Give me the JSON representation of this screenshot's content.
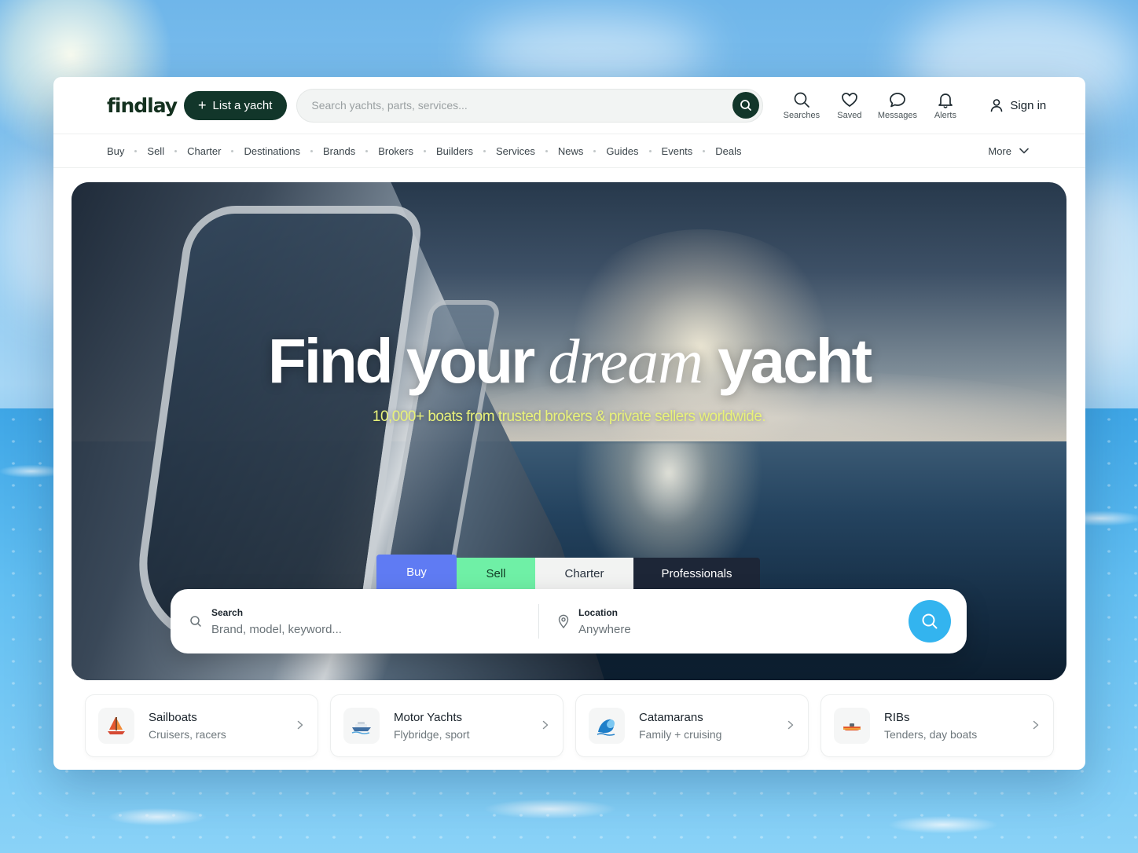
{
  "brand": {
    "name": "findlay"
  },
  "header": {
    "list_button": "List a yacht",
    "search_placeholder": "Search yachts, parts, services...",
    "actions": [
      {
        "label": "Searches",
        "icon": "search-icon"
      },
      {
        "label": "Saved",
        "icon": "heart-icon"
      },
      {
        "label": "Messages",
        "icon": "chat-bubble-icon"
      },
      {
        "label": "Alerts",
        "icon": "bell-icon"
      }
    ],
    "signin": "Sign in"
  },
  "nav": {
    "items": [
      "Buy",
      "Sell",
      "Charter",
      "Destinations",
      "Brands",
      "Brokers",
      "Builders",
      "Services",
      "News",
      "Guides",
      "Events",
      "Deals"
    ],
    "more": "More"
  },
  "hero": {
    "title_part1": "Find your",
    "title_em": "dream",
    "title_part2": "yacht",
    "subtitle": "10,000+ boats from trusted brokers & private sellers worldwide.",
    "tabs": [
      "Buy",
      "Sell",
      "Charter",
      "Professionals"
    ],
    "active_tab": "Buy",
    "search": {
      "label": "Search",
      "placeholder": "Brand, model, keyword..."
    },
    "location": {
      "label": "Location",
      "placeholder": "Anywhere"
    }
  },
  "categories": [
    {
      "title": "Sailboats",
      "subtitle": "Cruisers, racers",
      "icon": "sailboat-icon"
    },
    {
      "title": "Motor Yachts",
      "subtitle": "Flybridge, sport",
      "icon": "motor-yacht-icon"
    },
    {
      "title": "Catamarans",
      "subtitle": "Family + cruising",
      "icon": "wave-icon"
    },
    {
      "title": "RIBs",
      "subtitle": "Tenders, day boats",
      "icon": "rib-boat-icon"
    }
  ],
  "colors": {
    "brand_dark": "#12362a",
    "tab_buy": "#5f7bf3",
    "tab_sell": "#6ff0a6",
    "tab_charter": "#f2f3f2",
    "tab_professionals": "#1d2637",
    "search_go": "#33b4ef",
    "subtitle": "#e8f27a"
  }
}
